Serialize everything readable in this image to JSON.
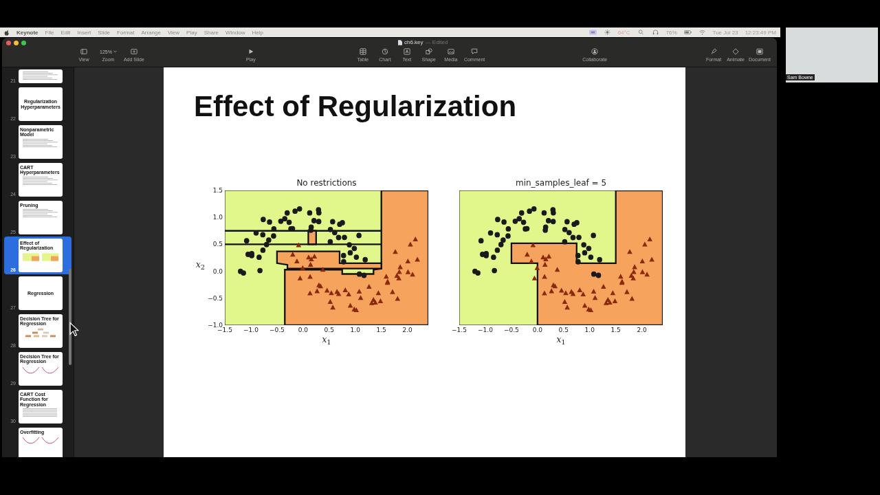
{
  "menu_bar": {
    "app": "Keynote",
    "menus": [
      "File",
      "Edit",
      "Insert",
      "Slide",
      "Format",
      "Arrange",
      "View",
      "Play",
      "Share",
      "Window",
      "Help"
    ],
    "temperature": "64°C",
    "battery": "76%",
    "date": "Tue Jul 23",
    "time": "12:23:49 PM"
  },
  "window": {
    "title": "ch6.key",
    "status": "— Edited"
  },
  "toolbar_groups": [
    [
      {
        "label": "View"
      },
      {
        "label": "Zoom",
        "value": "125%"
      },
      {
        "label": "Add Slide"
      }
    ],
    [
      {
        "label": "Play"
      }
    ],
    [
      {
        "label": "Table"
      },
      {
        "label": "Chart"
      },
      {
        "label": "Text"
      },
      {
        "label": "Shape"
      },
      {
        "label": "Media"
      },
      {
        "label": "Comment"
      }
    ],
    [
      {
        "label": "Collaborate"
      }
    ],
    [
      {
        "label": "Format"
      },
      {
        "label": "Animate"
      },
      {
        "label": "Document"
      }
    ]
  ],
  "slides": [
    {
      "number": "21",
      "kind": "bullets",
      "selected": false
    },
    {
      "number": "22",
      "kind": "title",
      "title": "Regularization Hyperparameters",
      "selected": false
    },
    {
      "number": "23",
      "kind": "bullets",
      "title": "Nonparametric Model",
      "selected": false
    },
    {
      "number": "24",
      "kind": "bullets",
      "title": "CART Hyperparameters",
      "selected": false
    },
    {
      "number": "25",
      "kind": "bullets",
      "title": "Pruning",
      "selected": false
    },
    {
      "number": "26",
      "kind": "plots",
      "title": "Effect of Regularization",
      "selected": true
    },
    {
      "number": "27",
      "kind": "title",
      "title": "Regression",
      "selected": false
    },
    {
      "number": "28",
      "kind": "tree",
      "title": "Decision Tree for Regression",
      "selected": false
    },
    {
      "number": "29",
      "kind": "curves",
      "title": "Decision Tree for Regression",
      "selected": false
    },
    {
      "number": "30",
      "kind": "formula",
      "title": "CART Cost Function for Regression",
      "selected": false
    },
    {
      "kind": "curves",
      "title": "Overfitting",
      "selected": false
    }
  ],
  "slide": {
    "title": "Effect of Regularization",
    "plots": [
      {
        "title": "No restrictions",
        "kind": "unrestricted",
        "ylabel": "*x*$_{2}$",
        "xlabel": "*x*$_{1}$",
        "yticks": [
          "1.5",
          "1.0",
          "0.5",
          "0.0",
          "−0.5",
          "−1.0"
        ],
        "xticks": [
          "−1.5",
          "−1.0",
          "−0.5",
          "0.0",
          "0.5",
          "1.0",
          "1.5",
          "2.0"
        ]
      },
      {
        "title": "min_samples_leaf = 5",
        "kind": "leaf5",
        "xlabel": "*x*$_{1}$",
        "xticks": [
          "−1.5",
          "−1.0",
          "−0.5",
          "0.0",
          "0.5",
          "1.0",
          "1.5",
          "2.0"
        ]
      }
    ]
  },
  "webcam": {
    "name": "Sam Bowne"
  }
}
